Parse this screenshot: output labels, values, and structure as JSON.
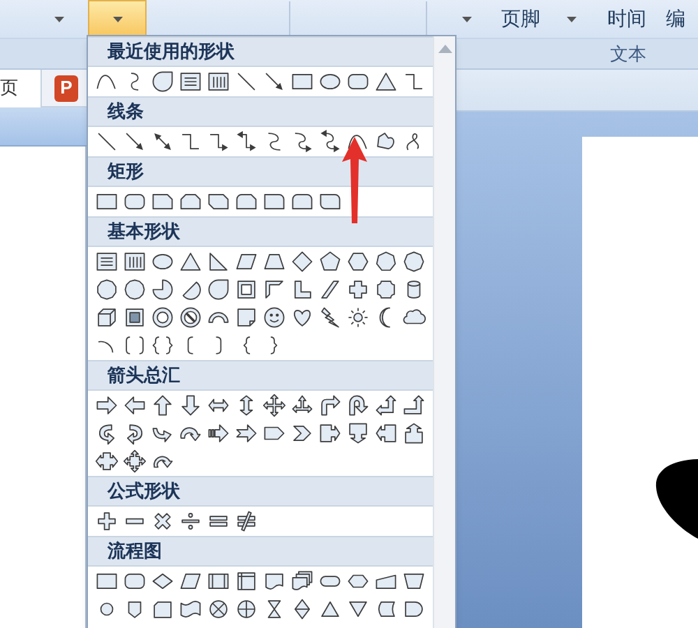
{
  "ribbon": {
    "shapes_button": {
      "expanded": true
    },
    "commands": [
      {
        "label": "页脚"
      },
      {
        "label": "时间"
      },
      {
        "label": "编"
      }
    ],
    "group_label": "文本"
  },
  "document_tabs": [
    {
      "label": "页"
    }
  ],
  "app_icon": {
    "letter": "P"
  },
  "shapes_menu": {
    "sections": [
      {
        "title": "最近使用的形状",
        "kind": "recent"
      },
      {
        "title": "线条",
        "kind": "lines"
      },
      {
        "title": "矩形",
        "kind": "rectangles"
      },
      {
        "title": "基本形状",
        "kind": "basic"
      },
      {
        "title": "箭头总汇",
        "kind": "arrows"
      },
      {
        "title": "公式形状",
        "kind": "equation"
      },
      {
        "title": "流程图",
        "kind": "flowchart"
      }
    ]
  }
}
